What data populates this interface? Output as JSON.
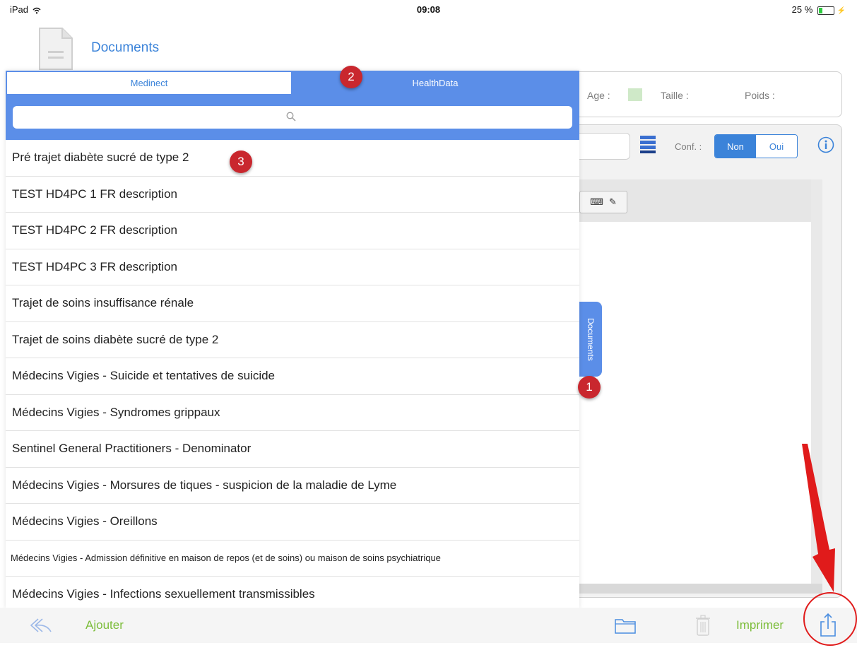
{
  "status_bar": {
    "device": "iPad",
    "time": "09:08",
    "battery": "25 %",
    "battery_level": 0.25
  },
  "header": {
    "title": "Documents",
    "icon": "document-icon"
  },
  "patient_fields": {
    "age_label": "Age :",
    "height_label": "Taille :",
    "weight_label": "Poids :"
  },
  "confidential": {
    "label": "Conf. :",
    "no": "Non",
    "yes": "Oui",
    "selected": "Non"
  },
  "side_tab": {
    "label": "Documents"
  },
  "popover": {
    "tabs": [
      {
        "label": "Medinect",
        "selected": false
      },
      {
        "label": "HealthData",
        "selected": true
      }
    ],
    "search": {
      "placeholder": "",
      "icon": "search-icon"
    },
    "items": [
      "Pré trajet diabète sucré de type 2",
      "TEST HD4PC 1 FR description",
      "TEST HD4PC 2 FR description",
      "TEST HD4PC 3 FR description",
      "Trajet de soins insuffisance rénale",
      "Trajet de soins diabète sucré de type 2",
      "Médecins Vigies - Suicide et tentatives de suicide",
      "Médecins Vigies - Syndromes grippaux",
      "Sentinel General Practitioners - Denominator",
      "Médecins Vigies - Morsures de tiques - suspicion de la maladie de Lyme",
      "Médecins Vigies - Oreillons",
      "Médecins Vigies - Admission définitive en maison de repos (et de soins) ou maison de soins psychiatrique",
      "Médecins Vigies - Infections sexuellement transmissibles"
    ]
  },
  "callouts": {
    "one": "1",
    "two": "2",
    "three": "3"
  },
  "toolbar": {
    "add_label": "Ajouter",
    "print_label": "Imprimer"
  },
  "colors": {
    "accent": "#3b83d9",
    "header_blue": "#5b8ee8",
    "action_green": "#7cbd3a",
    "callout_red": "#c9272e"
  }
}
